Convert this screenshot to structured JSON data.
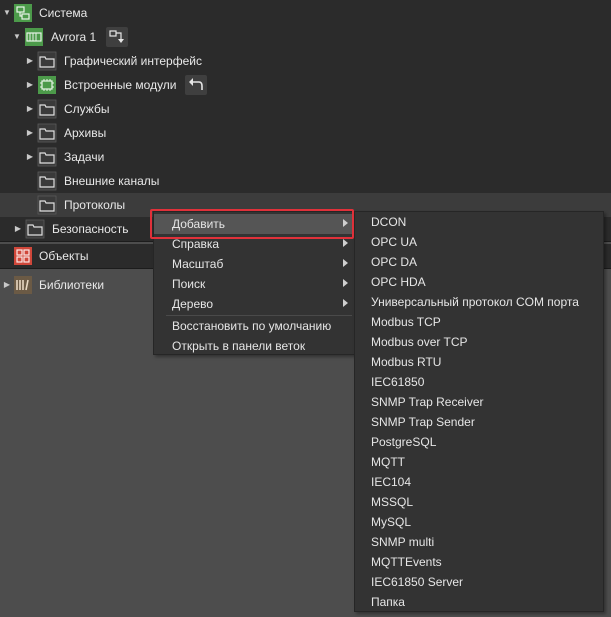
{
  "tree": {
    "system": "Система",
    "avrora": "Avrora 1",
    "items": [
      "Графический интерфейс",
      "Встроенные модули",
      "Службы",
      "Архивы",
      "Задачи",
      "Внешние каналы",
      "Протоколы"
    ],
    "security": "Безопасность",
    "objects": "Объекты",
    "libraries": "Библиотеки"
  },
  "context_menu": {
    "items": [
      "Добавить",
      "Справка",
      "Масштаб",
      "Поиск",
      "Дерево"
    ],
    "actions": [
      "Восстановить по умолчанию",
      "Открыть в панели веток"
    ]
  },
  "submenu": {
    "items": [
      "DCON",
      "OPC UA",
      "OPC DA",
      "OPC HDA",
      "Универсальный протокол COM порта",
      "Modbus TCP",
      "Modbus over TCP",
      "Modbus RTU",
      "IEC61850",
      "SNMP Trap Receiver",
      "SNMP Trap Sender",
      "PostgreSQL",
      "MQTT",
      "IEC104",
      "MSSQL",
      "MySQL",
      "SNMP multi",
      "MQTTEvents",
      "IEC61850 Server",
      "Папка"
    ]
  },
  "colors": {
    "highlight_border": "#e0313a",
    "system_icon": "#4c9a4a",
    "objects_icon": "#d0473a",
    "library_icon": "#b07b3a"
  }
}
